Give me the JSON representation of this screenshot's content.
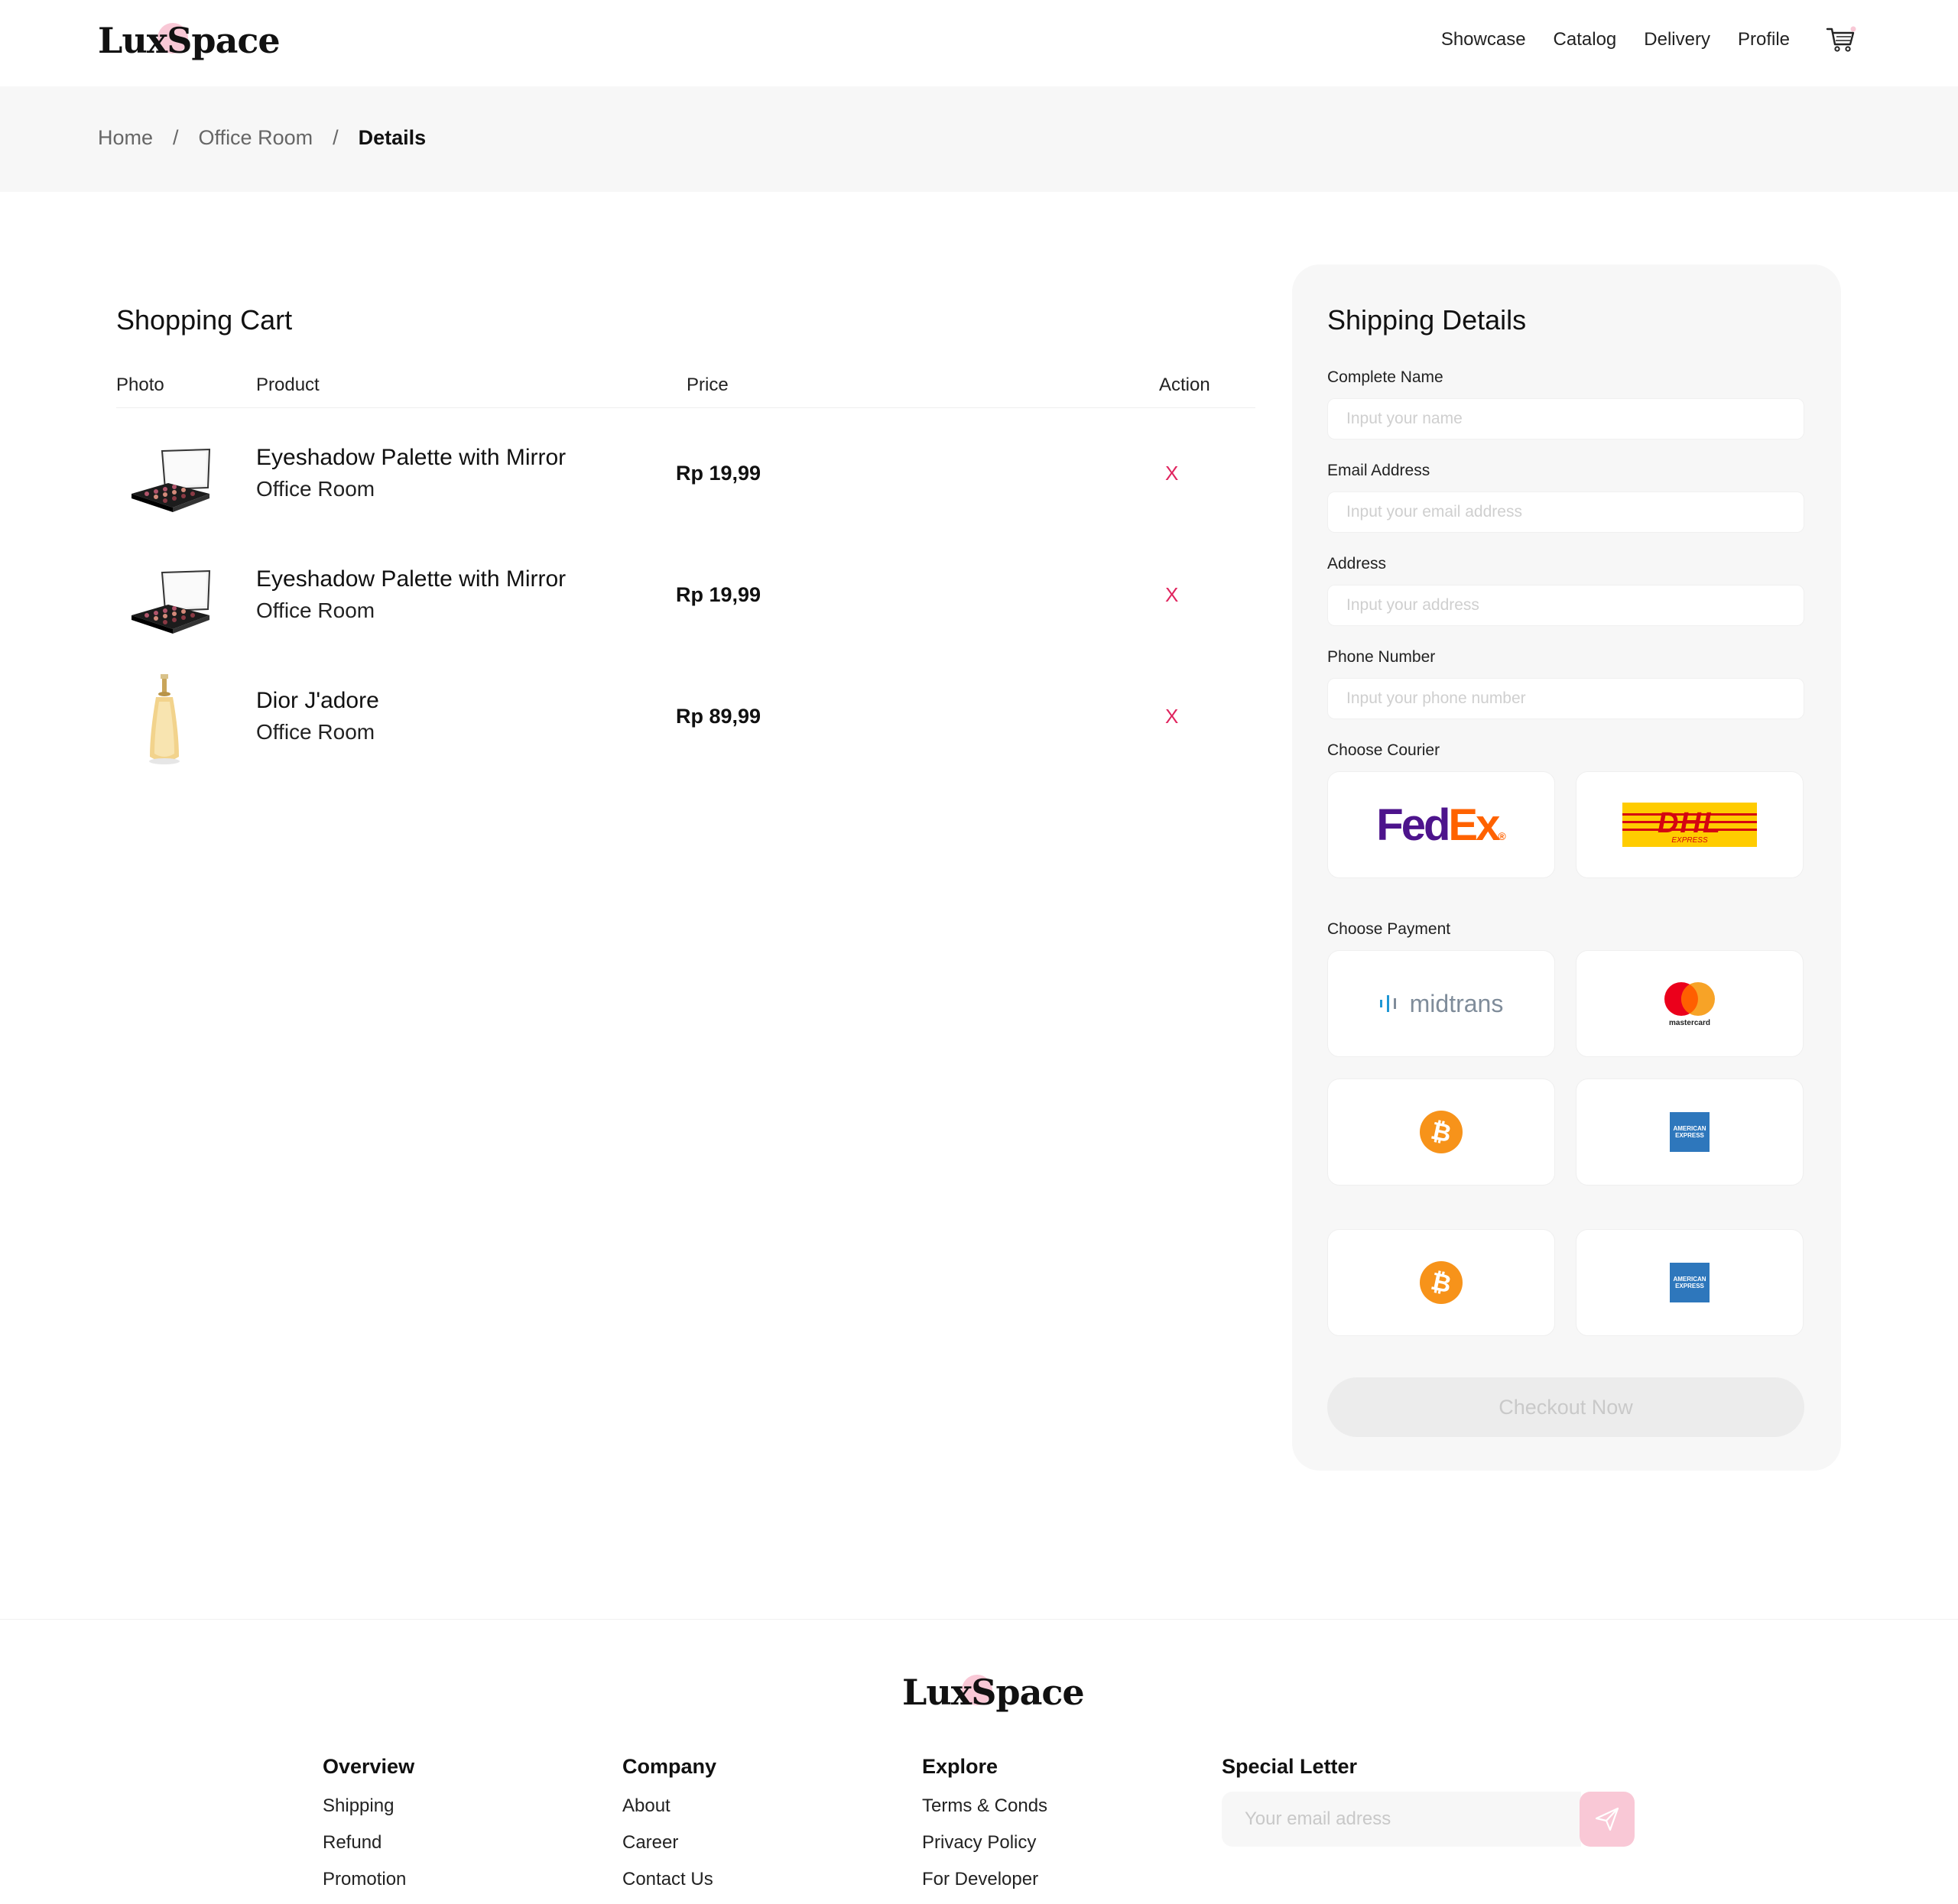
{
  "brand": {
    "name": "LuxSpace"
  },
  "nav": {
    "items": [
      {
        "label": "Showcase"
      },
      {
        "label": "Catalog"
      },
      {
        "label": "Delivery"
      },
      {
        "label": "Profile"
      }
    ],
    "cart_icon": "cart-icon"
  },
  "breadcrumb": {
    "items": [
      "Home",
      "Office Room",
      "Details"
    ],
    "separator": "/"
  },
  "cart": {
    "title": "Shopping Cart",
    "columns": [
      "Photo",
      "Product",
      "Price",
      "Action"
    ],
    "rows": [
      {
        "name": "Eyeshadow Palette with Mirror",
        "category": "Office Room",
        "price": "Rp 19,99",
        "action": "X",
        "image": "eyeshadow-palette"
      },
      {
        "name": "Eyeshadow Palette with Mirror",
        "category": "Office Room",
        "price": "Rp 19,99",
        "action": "X",
        "image": "eyeshadow-palette"
      },
      {
        "name": "Dior J'adore",
        "category": "Office Room",
        "price": "Rp 89,99",
        "action": "X",
        "image": "perfume-bottle"
      }
    ]
  },
  "shipping": {
    "title": "Shipping Details",
    "fields": {
      "name": {
        "label": "Complete Name",
        "placeholder": "Input your name",
        "value": ""
      },
      "email": {
        "label": "Email Address",
        "placeholder": "Input your email address",
        "value": ""
      },
      "address": {
        "label": "Address",
        "placeholder": "Input your address",
        "value": ""
      },
      "phone": {
        "label": "Phone Number",
        "placeholder": "Input your phone number",
        "value": ""
      }
    },
    "courier": {
      "label": "Choose Courier",
      "options": [
        {
          "brand": "FedEx",
          "brand_a": "Fed",
          "brand_b": "Ex",
          "color_a": "#4d148c",
          "color_b": "#ff6200"
        },
        {
          "brand": "DHL",
          "sub": "EXPRESS",
          "color_a": "#ffcc00",
          "color_b": "#d40511"
        }
      ]
    },
    "payment": {
      "label": "Choose Payment",
      "options": [
        {
          "brand": "midtrans",
          "color": "#7f8c9a",
          "accent": "#1f97d4"
        },
        {
          "brand": "mastercard",
          "color_a": "#eb001b",
          "color_b": "#f79e1b"
        },
        {
          "brand": "bitcoin",
          "color": "#f7931a"
        },
        {
          "brand": "american-express",
          "brand_text": "AMERICAN EXPRESS",
          "color": "#2e77bc"
        },
        {
          "brand": "bitcoin",
          "color": "#f7931a"
        },
        {
          "brand": "american-express",
          "brand_text": "AMERICAN EXPRESS",
          "color": "#2e77bc"
        }
      ]
    },
    "checkout_label": "Checkout Now"
  },
  "footer": {
    "columns": [
      {
        "title": "Overview",
        "links": [
          "Shipping",
          "Refund",
          "Promotion"
        ]
      },
      {
        "title": "Company",
        "links": [
          "About",
          "Career",
          "Contact Us"
        ]
      },
      {
        "title": "Explore",
        "links": [
          "Terms & Conds",
          "Privacy Policy",
          "For Developer"
        ]
      }
    ],
    "newsletter": {
      "title": "Special Letter",
      "placeholder": "Your email adress",
      "icon": "send-icon"
    }
  },
  "colors": {
    "accent_pink": "#f9c8d6",
    "remove_red": "#e0245e",
    "panel_bg": "#f7f7f7"
  }
}
